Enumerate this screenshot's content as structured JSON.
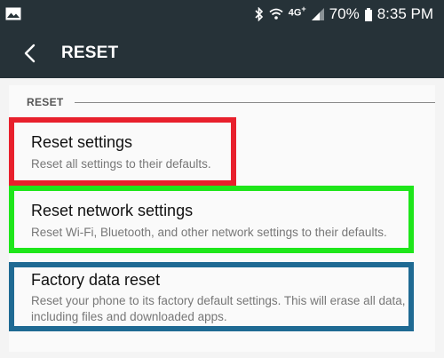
{
  "status_bar": {
    "network": "4G",
    "network_plus": "+",
    "battery_percent": "70%",
    "time": "8:35 PM",
    "icons": [
      "gallery-icon",
      "bluetooth-icon",
      "wifi-icon",
      "signal-icon",
      "battery-icon"
    ]
  },
  "app_bar": {
    "title": "RESET",
    "back_icon": "back-arrow-icon"
  },
  "section": {
    "header": "RESET"
  },
  "items": [
    {
      "title": "Reset settings",
      "description": "Reset all settings to their defaults.",
      "highlight_color": "#e8202c"
    },
    {
      "title": "Reset network settings",
      "description": "Reset Wi-Fi, Bluetooth, and other network settings to their defaults.",
      "highlight_color": "#1ee61a"
    },
    {
      "title": "Factory data reset",
      "description": "Reset your phone to its factory default settings. This will erase all data, including files and downloaded apps.",
      "highlight_color": "#1f6a93"
    }
  ],
  "colors": {
    "bar_background": "#263238",
    "page_background": "#f4f4f4"
  }
}
